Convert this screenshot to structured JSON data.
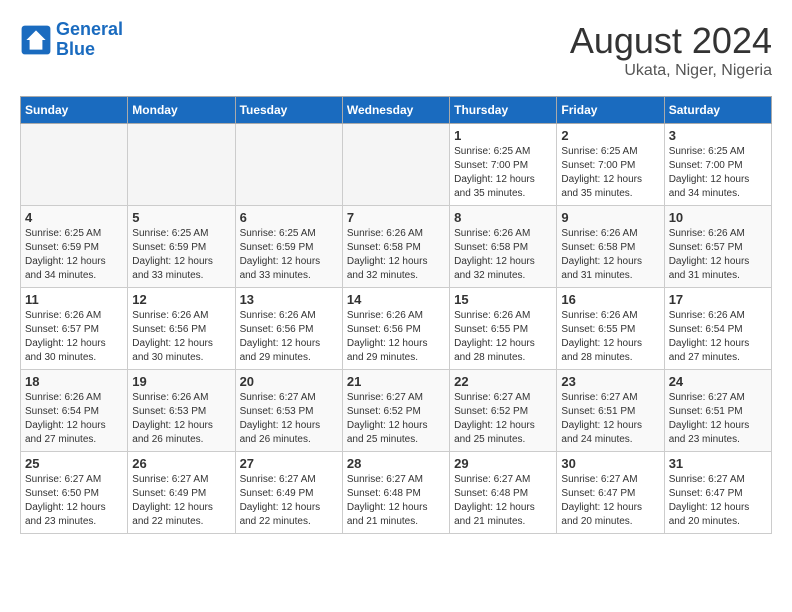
{
  "header": {
    "logo_line1": "General",
    "logo_line2": "Blue",
    "title": "August 2024",
    "subtitle": "Ukata, Niger, Nigeria"
  },
  "weekdays": [
    "Sunday",
    "Monday",
    "Tuesday",
    "Wednesday",
    "Thursday",
    "Friday",
    "Saturday"
  ],
  "weeks": [
    [
      {
        "day": "",
        "info": ""
      },
      {
        "day": "",
        "info": ""
      },
      {
        "day": "",
        "info": ""
      },
      {
        "day": "",
        "info": ""
      },
      {
        "day": "1",
        "info": "Sunrise: 6:25 AM\nSunset: 7:00 PM\nDaylight: 12 hours\nand 35 minutes."
      },
      {
        "day": "2",
        "info": "Sunrise: 6:25 AM\nSunset: 7:00 PM\nDaylight: 12 hours\nand 35 minutes."
      },
      {
        "day": "3",
        "info": "Sunrise: 6:25 AM\nSunset: 7:00 PM\nDaylight: 12 hours\nand 34 minutes."
      }
    ],
    [
      {
        "day": "4",
        "info": "Sunrise: 6:25 AM\nSunset: 6:59 PM\nDaylight: 12 hours\nand 34 minutes."
      },
      {
        "day": "5",
        "info": "Sunrise: 6:25 AM\nSunset: 6:59 PM\nDaylight: 12 hours\nand 33 minutes."
      },
      {
        "day": "6",
        "info": "Sunrise: 6:25 AM\nSunset: 6:59 PM\nDaylight: 12 hours\nand 33 minutes."
      },
      {
        "day": "7",
        "info": "Sunrise: 6:26 AM\nSunset: 6:58 PM\nDaylight: 12 hours\nand 32 minutes."
      },
      {
        "day": "8",
        "info": "Sunrise: 6:26 AM\nSunset: 6:58 PM\nDaylight: 12 hours\nand 32 minutes."
      },
      {
        "day": "9",
        "info": "Sunrise: 6:26 AM\nSunset: 6:58 PM\nDaylight: 12 hours\nand 31 minutes."
      },
      {
        "day": "10",
        "info": "Sunrise: 6:26 AM\nSunset: 6:57 PM\nDaylight: 12 hours\nand 31 minutes."
      }
    ],
    [
      {
        "day": "11",
        "info": "Sunrise: 6:26 AM\nSunset: 6:57 PM\nDaylight: 12 hours\nand 30 minutes."
      },
      {
        "day": "12",
        "info": "Sunrise: 6:26 AM\nSunset: 6:56 PM\nDaylight: 12 hours\nand 30 minutes."
      },
      {
        "day": "13",
        "info": "Sunrise: 6:26 AM\nSunset: 6:56 PM\nDaylight: 12 hours\nand 29 minutes."
      },
      {
        "day": "14",
        "info": "Sunrise: 6:26 AM\nSunset: 6:56 PM\nDaylight: 12 hours\nand 29 minutes."
      },
      {
        "day": "15",
        "info": "Sunrise: 6:26 AM\nSunset: 6:55 PM\nDaylight: 12 hours\nand 28 minutes."
      },
      {
        "day": "16",
        "info": "Sunrise: 6:26 AM\nSunset: 6:55 PM\nDaylight: 12 hours\nand 28 minutes."
      },
      {
        "day": "17",
        "info": "Sunrise: 6:26 AM\nSunset: 6:54 PM\nDaylight: 12 hours\nand 27 minutes."
      }
    ],
    [
      {
        "day": "18",
        "info": "Sunrise: 6:26 AM\nSunset: 6:54 PM\nDaylight: 12 hours\nand 27 minutes."
      },
      {
        "day": "19",
        "info": "Sunrise: 6:26 AM\nSunset: 6:53 PM\nDaylight: 12 hours\nand 26 minutes."
      },
      {
        "day": "20",
        "info": "Sunrise: 6:27 AM\nSunset: 6:53 PM\nDaylight: 12 hours\nand 26 minutes."
      },
      {
        "day": "21",
        "info": "Sunrise: 6:27 AM\nSunset: 6:52 PM\nDaylight: 12 hours\nand 25 minutes."
      },
      {
        "day": "22",
        "info": "Sunrise: 6:27 AM\nSunset: 6:52 PM\nDaylight: 12 hours\nand 25 minutes."
      },
      {
        "day": "23",
        "info": "Sunrise: 6:27 AM\nSunset: 6:51 PM\nDaylight: 12 hours\nand 24 minutes."
      },
      {
        "day": "24",
        "info": "Sunrise: 6:27 AM\nSunset: 6:51 PM\nDaylight: 12 hours\nand 23 minutes."
      }
    ],
    [
      {
        "day": "25",
        "info": "Sunrise: 6:27 AM\nSunset: 6:50 PM\nDaylight: 12 hours\nand 23 minutes."
      },
      {
        "day": "26",
        "info": "Sunrise: 6:27 AM\nSunset: 6:49 PM\nDaylight: 12 hours\nand 22 minutes."
      },
      {
        "day": "27",
        "info": "Sunrise: 6:27 AM\nSunset: 6:49 PM\nDaylight: 12 hours\nand 22 minutes."
      },
      {
        "day": "28",
        "info": "Sunrise: 6:27 AM\nSunset: 6:48 PM\nDaylight: 12 hours\nand 21 minutes."
      },
      {
        "day": "29",
        "info": "Sunrise: 6:27 AM\nSunset: 6:48 PM\nDaylight: 12 hours\nand 21 minutes."
      },
      {
        "day": "30",
        "info": "Sunrise: 6:27 AM\nSunset: 6:47 PM\nDaylight: 12 hours\nand 20 minutes."
      },
      {
        "day": "31",
        "info": "Sunrise: 6:27 AM\nSunset: 6:47 PM\nDaylight: 12 hours\nand 20 minutes."
      }
    ]
  ]
}
